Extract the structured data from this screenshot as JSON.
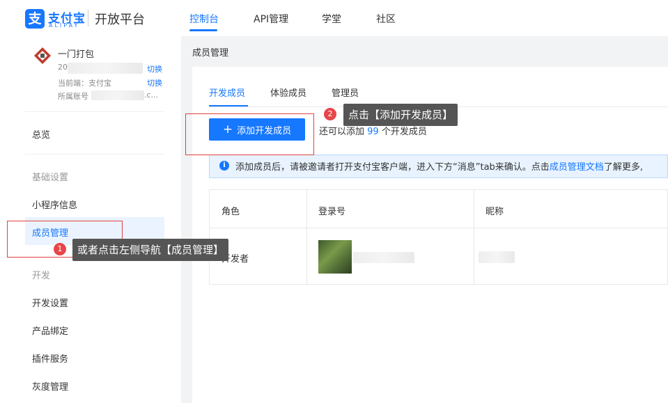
{
  "header": {
    "logo_cn": "支付宝",
    "logo_en": "ALIPAY",
    "platform_title": "开放平台",
    "nav": [
      {
        "label": "控制台"
      },
      {
        "label": "API管理"
      },
      {
        "label": "学堂"
      },
      {
        "label": "社区"
      }
    ]
  },
  "sidebar": {
    "account_name": "一门打包",
    "account_id_prefix": "20",
    "switch_label_1": "切换",
    "current_end": "当前端：支付宝",
    "switch_label_2": "切换",
    "owner_prefix": "所属账号",
    "owner_suffix": ".c...",
    "overview": "总览",
    "group_basic": "基础设置",
    "item_miniapp_info": "小程序信息",
    "item_member_mgmt": "成员管理",
    "group_dev": "开发",
    "item_dev_settings": "开发设置",
    "item_product_bind": "产品绑定",
    "item_plugin": "插件服务",
    "item_gray": "灰度管理"
  },
  "main": {
    "breadcrumb": "成员管理",
    "tabs": [
      {
        "label": "开发成员"
      },
      {
        "label": "体验成员"
      },
      {
        "label": "管理员"
      }
    ],
    "add_button": "添加开发成员",
    "add_plus": "+",
    "remaining_prefix": "还可以添加",
    "remaining_count": "99",
    "remaining_suffix": "个开发成员",
    "info_icon": "i",
    "info_text": "添加成员后，请被邀请者打开支付宝客户端，进入下方“消息”tab来确认。点击",
    "info_link": "成员管理文档",
    "info_tail": "了解更多,",
    "table": {
      "columns": [
        "角色",
        "登录号",
        "昵称"
      ],
      "rows": [
        {
          "role": "开发者"
        }
      ]
    }
  },
  "annotations": {
    "step1_num": "1",
    "step1_text": "或者点击左侧导航【成员管理】",
    "step2_num": "2",
    "step2_text": "点击【添加开发成员】"
  },
  "colors": {
    "accent": "#1677ff",
    "annotation_red": "#e34040",
    "tooltip_bg": "#555555"
  }
}
